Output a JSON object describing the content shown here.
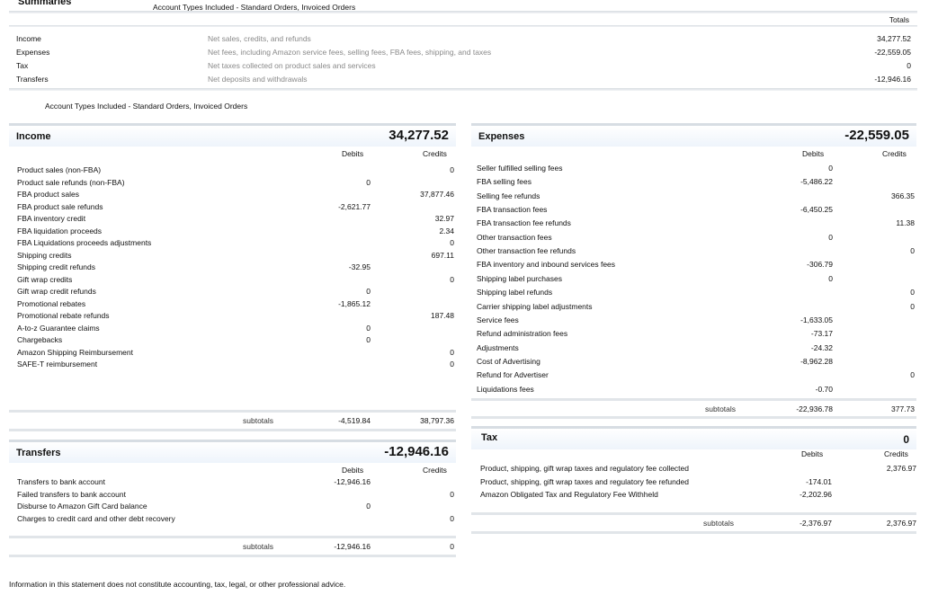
{
  "summaries": {
    "title": "Summaries",
    "subtitle": "Account Types Included - Standard Orders, Invoiced Orders",
    "totals_label": "Totals",
    "rows": [
      {
        "label": "Income",
        "desc": "Net sales, credits, and refunds",
        "value": "34,277.52"
      },
      {
        "label": "Expenses",
        "desc": "Net fees, including Amazon service fees, selling fees, FBA fees, shipping, and taxes",
        "value": "-22,559.05"
      },
      {
        "label": "Tax",
        "desc": "Net taxes collected on product sales and services",
        "value": "0"
      },
      {
        "label": "Transfers",
        "desc": "Net deposits and withdrawals",
        "value": "-12,946.16"
      }
    ]
  },
  "account_note": "Account Types Included - Standard Orders, Invoiced Orders",
  "income": {
    "title": "Income",
    "total": "34,277.52",
    "debits_label": "Debits",
    "credits_label": "Credits",
    "rows": [
      {
        "label": "Product sales (non-FBA)",
        "debit": "",
        "credit": "0"
      },
      {
        "label": "Product sale refunds (non-FBA)",
        "debit": "0",
        "credit": ""
      },
      {
        "label": "FBA product sales",
        "debit": "",
        "credit": "37,877.46"
      },
      {
        "label": "FBA product sale refunds",
        "debit": "-2,621.77",
        "credit": ""
      },
      {
        "label": "FBA inventory credit",
        "debit": "",
        "credit": "32.97"
      },
      {
        "label": "FBA liquidation proceeds",
        "debit": "",
        "credit": "2.34"
      },
      {
        "label": "FBA Liquidations proceeds adjustments",
        "debit": "",
        "credit": "0"
      },
      {
        "label": "Shipping credits",
        "debit": "",
        "credit": "697.11"
      },
      {
        "label": "Shipping credit refunds",
        "debit": "-32.95",
        "credit": ""
      },
      {
        "label": "Gift wrap credits",
        "debit": "",
        "credit": "0"
      },
      {
        "label": "Gift wrap credit refunds",
        "debit": "0",
        "credit": ""
      },
      {
        "label": "Promotional rebates",
        "debit": "-1,865.12",
        "credit": ""
      },
      {
        "label": "Promotional rebate refunds",
        "debit": "",
        "credit": "187.48"
      },
      {
        "label": "A-to-z Guarantee claims",
        "debit": "0",
        "credit": ""
      },
      {
        "label": "Chargebacks",
        "debit": "0",
        "credit": ""
      },
      {
        "label": "Amazon Shipping Reimbursement",
        "debit": "",
        "credit": "0"
      },
      {
        "label": "SAFE-T reimbursement",
        "debit": "",
        "credit": "0"
      }
    ],
    "subtotals_label": "subtotals",
    "subtotal_debit": "-4,519.84",
    "subtotal_credit": "38,797.36"
  },
  "expenses": {
    "title": "Expenses",
    "total": "-22,559.05",
    "debits_label": "Debits",
    "credits_label": "Credits",
    "rows": [
      {
        "label": "Seller fulfilled selling fees",
        "debit": "0",
        "credit": ""
      },
      {
        "label": "FBA selling fees",
        "debit": "-5,486.22",
        "credit": ""
      },
      {
        "label": "Selling fee refunds",
        "debit": "",
        "credit": "366.35"
      },
      {
        "label": "FBA transaction fees",
        "debit": "-6,450.25",
        "credit": ""
      },
      {
        "label": "FBA transaction fee refunds",
        "debit": "",
        "credit": "11.38"
      },
      {
        "label": "Other transaction fees",
        "debit": "0",
        "credit": ""
      },
      {
        "label": "Other transaction fee refunds",
        "debit": "",
        "credit": "0"
      },
      {
        "label": "FBA inventory and inbound services fees",
        "debit": "-306.79",
        "credit": ""
      },
      {
        "label": "Shipping label purchases",
        "debit": "0",
        "credit": ""
      },
      {
        "label": "Shipping label refunds",
        "debit": "",
        "credit": "0"
      },
      {
        "label": "Carrier shipping label adjustments",
        "debit": "",
        "credit": "0"
      },
      {
        "label": "Service fees",
        "debit": "-1,633.05",
        "credit": ""
      },
      {
        "label": "Refund administration fees",
        "debit": "-73.17",
        "credit": ""
      },
      {
        "label": "Adjustments",
        "debit": "-24.32",
        "credit": ""
      },
      {
        "label": "Cost of Advertising",
        "debit": "-8,962.28",
        "credit": ""
      },
      {
        "label": "Refund for Advertiser",
        "debit": "",
        "credit": "0"
      },
      {
        "label": "Liquidations fees",
        "debit": "-0.70",
        "credit": ""
      }
    ],
    "subtotals_label": "subtotals",
    "subtotal_debit": "-22,936.78",
    "subtotal_credit": "377.73"
  },
  "transfers": {
    "title": "Transfers",
    "total": "-12,946.16",
    "debits_label": "Debits",
    "credits_label": "Credits",
    "rows": [
      {
        "label": "Transfers to bank account",
        "debit": "-12,946.16",
        "credit": ""
      },
      {
        "label": "Failed transfers to bank account",
        "debit": "",
        "credit": "0"
      },
      {
        "label": "Disburse to Amazon Gift Card balance",
        "debit": "0",
        "credit": ""
      },
      {
        "label": "Charges to credit card and other debt recovery",
        "debit": "",
        "credit": "0"
      }
    ],
    "subtotals_label": "subtotals",
    "subtotal_debit": "-12,946.16",
    "subtotal_credit": "0"
  },
  "tax": {
    "title": "Tax",
    "total": "0",
    "debits_label": "Debits",
    "credits_label": "Credits",
    "rows": [
      {
        "label": "Product, shipping, gift wrap taxes and regulatory fee collected",
        "debit": "",
        "credit": "2,376.97"
      },
      {
        "label": "Product, shipping, gift wrap taxes and regulatory fee refunded",
        "debit": "-174.01",
        "credit": ""
      },
      {
        "label": "Amazon Obligated Tax and Regulatory Fee Withheld",
        "debit": "-2,202.96",
        "credit": ""
      }
    ],
    "subtotals_label": "subtotals",
    "subtotal_debit": "-2,376.97",
    "subtotal_credit": "2,376.97"
  },
  "footer_note": "Information in this statement does not constitute accounting, tax, legal, or other professional advice."
}
